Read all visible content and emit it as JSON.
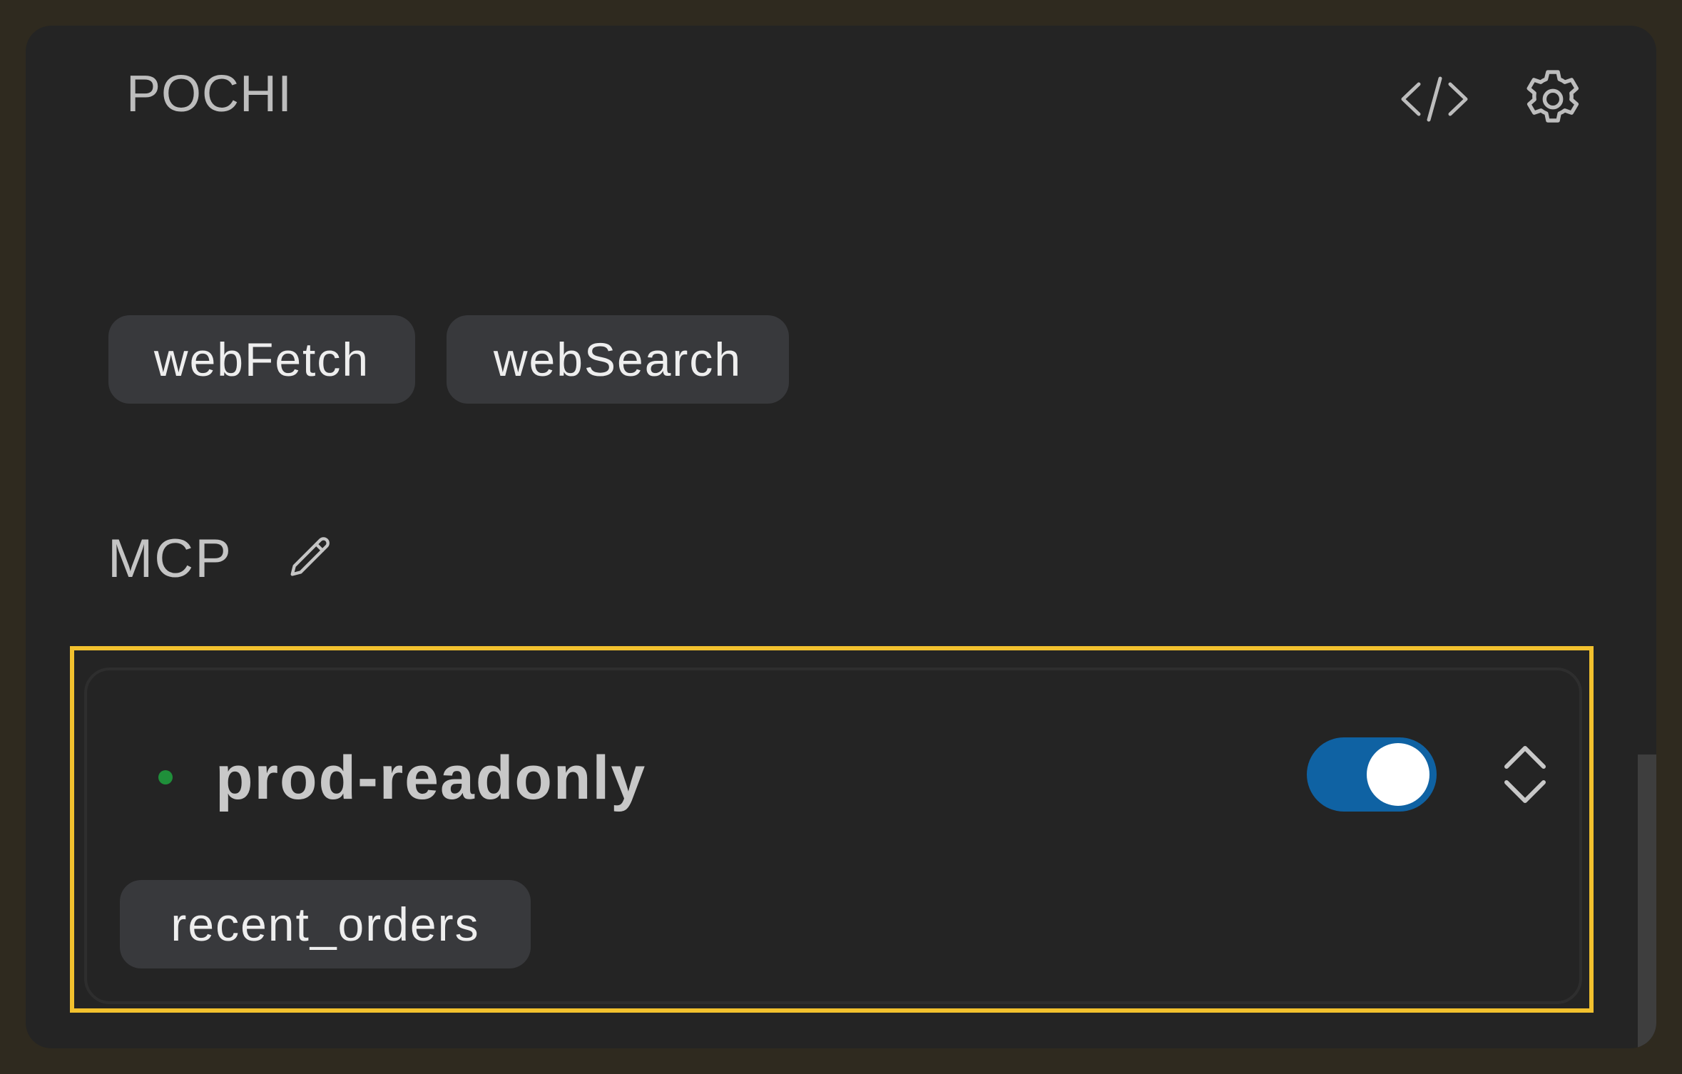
{
  "header": {
    "title": "POCHI",
    "icons": [
      "code-icon",
      "gear-icon"
    ]
  },
  "tools": {
    "chips": [
      "webFetch",
      "webSearch"
    ]
  },
  "mcp": {
    "label": "MCP",
    "edit_icon": "pencil-icon",
    "servers": [
      {
        "name": "prod-readonly",
        "status": "connected",
        "status_color": "#1f8f3a",
        "enabled": true,
        "toggle_color": "#0f62a3",
        "tools": [
          "recent_orders"
        ]
      }
    ]
  },
  "colors": {
    "highlight": "#f2c12e",
    "panel_bg": "#242424",
    "chip_bg": "#38393c"
  }
}
